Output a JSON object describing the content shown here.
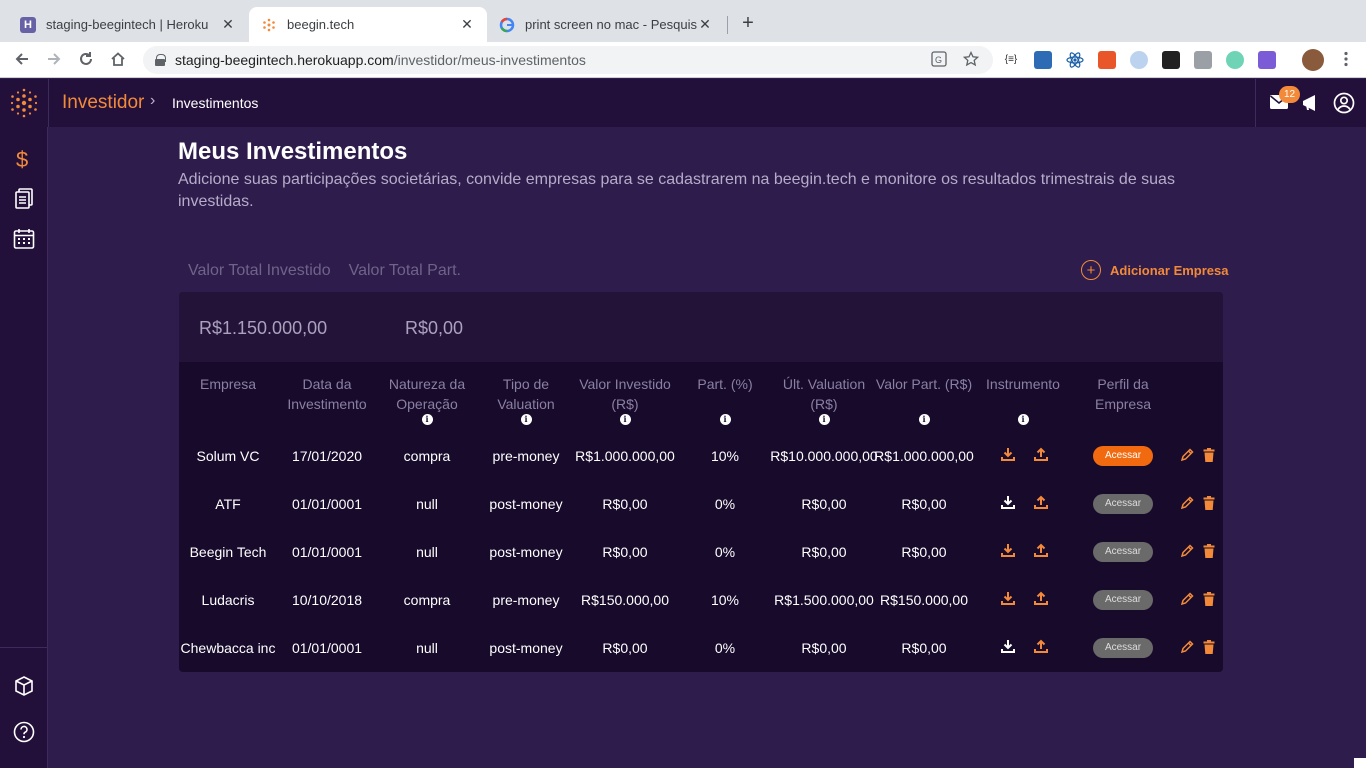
{
  "browser": {
    "tabs": [
      {
        "title": "staging-beegintech | Heroku",
        "active": false
      },
      {
        "title": "beegin.tech",
        "active": true
      },
      {
        "title": "print screen no mac - Pesquisa G",
        "active": false
      }
    ],
    "url_host": "staging-beegintech.herokuapp.com",
    "url_path": "/investidor/meus-investimentos",
    "new_tab": "+"
  },
  "header": {
    "breadcrumb_main": "Investidor",
    "breadcrumb_sep": "›",
    "breadcrumb_sub": "Investimentos",
    "notification_count": "12"
  },
  "main": {
    "title": "Meus Investimentos",
    "subtitle": "Adicione suas participações societárias, convide empresas para se cadastrarem na beegin.tech e monitore os resultados trimestrais de suas investidas.",
    "total_invested_label": "Valor Total Investido",
    "total_part_label": "Valor Total Part.",
    "total_invested_value": "R$1.150.000,00",
    "total_part_value": "R$0,00",
    "add_company": "Adicionar Empresa",
    "add_icon": "+"
  },
  "table": {
    "columns": [
      {
        "label": "Empresa",
        "info": false
      },
      {
        "label": "Data da Investimento",
        "info": false
      },
      {
        "label": "Natureza da Operação",
        "info": true
      },
      {
        "label": "Tipo de Valuation",
        "info": true
      },
      {
        "label": "Valor Investido (R$)",
        "info": true
      },
      {
        "label": "Part. (%)",
        "info": true
      },
      {
        "label": "Últ. Valuation (R$)",
        "info": true
      },
      {
        "label": "Valor Part. (R$)",
        "info": true
      },
      {
        "label": "Instrumento",
        "info": true
      },
      {
        "label": "Perfil da Empresa",
        "info": false
      }
    ],
    "info_glyph": "i",
    "rows": [
      {
        "empresa": "Solum VC",
        "data": "17/01/2020",
        "natureza": "compra",
        "tipo": "pre-money",
        "valor_investido": "R$1.000.000,00",
        "part": "10%",
        "ult_valuation": "R$10.000.000,00",
        "valor_part": "R$1.000.000,00",
        "acessar": "Acessar",
        "active": true,
        "download_color": "#f28a3a"
      },
      {
        "empresa": "ATF",
        "data": "01/01/0001",
        "natureza": "null",
        "tipo": "post-money",
        "valor_investido": "R$0,00",
        "part": "0%",
        "ult_valuation": "R$0,00",
        "valor_part": "R$0,00",
        "acessar": "Acessar",
        "active": false,
        "download_color": "#ffffff"
      },
      {
        "empresa": "Beegin Tech",
        "data": "01/01/0001",
        "natureza": "null",
        "tipo": "post-money",
        "valor_investido": "R$0,00",
        "part": "0%",
        "ult_valuation": "R$0,00",
        "valor_part": "R$0,00",
        "acessar": "Acessar",
        "active": false,
        "download_color": "#f28a3a"
      },
      {
        "empresa": "Ludacris",
        "data": "10/10/2018",
        "natureza": "compra",
        "tipo": "pre-money",
        "valor_investido": "R$150.000,00",
        "part": "10%",
        "ult_valuation": "R$1.500.000,00",
        "valor_part": "R$150.000,00",
        "acessar": "Acessar",
        "active": false,
        "download_color": "#f28a3a"
      },
      {
        "empresa": "Chewbacca inc",
        "data": "01/01/0001",
        "natureza": "null",
        "tipo": "post-money",
        "valor_investido": "R$0,00",
        "part": "0%",
        "ult_valuation": "R$0,00",
        "valor_part": "R$0,00",
        "acessar": "Acessar",
        "active": false,
        "download_color": "#ffffff"
      }
    ]
  },
  "colors": {
    "accent": "#f28a3a",
    "page_bg": "#2d1c4c",
    "header_bg": "#22103a",
    "table_bg": "#170a2b",
    "muted_text": "#8a80a2"
  }
}
